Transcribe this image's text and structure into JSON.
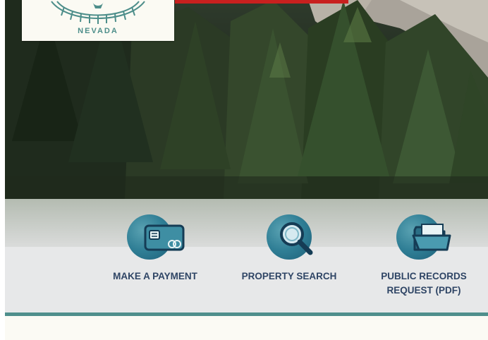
{
  "header": {
    "logo_text": "NEVADA",
    "accent_color": "#c8201f"
  },
  "hero": {
    "image_subject": "pine forest with rocky cliffs"
  },
  "quick_links": [
    {
      "label": "MAKE A PAYMENT",
      "icon": "credit-card-icon"
    },
    {
      "label": "PROPERTY SEARCH",
      "icon": "magnifying-glass-icon"
    },
    {
      "label": "PUBLIC RECORDS REQUEST (PDF)",
      "icon": "folder-icon"
    }
  ],
  "colors": {
    "link_text": "#2f4565",
    "icon_circle": "#2f7e95",
    "rule": "#4f8f8c"
  }
}
